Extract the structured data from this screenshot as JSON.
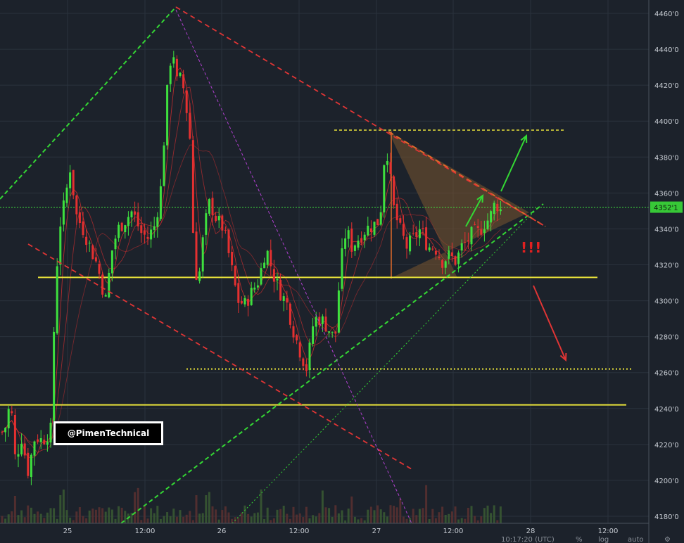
{
  "chart_data": {
    "type": "candlestick",
    "y_ticks": [
      "4460'0",
      "4440'0",
      "4420'0",
      "4400'0",
      "4380'0",
      "4360'0",
      "4340'0",
      "4320'0",
      "4300'0",
      "4280'0",
      "4260'0",
      "4240'0",
      "4220'0",
      "4200'0",
      "4180'0"
    ],
    "x_ticks": [
      "25",
      "12:00",
      "26",
      "12:00",
      "27",
      "12:00",
      "28",
      "12:00"
    ],
    "ylim": [
      4178,
      4466
    ],
    "current_price": "4352'1",
    "current_price_value": 4352.1,
    "levels": [
      {
        "name": "support-upper",
        "value": 4313,
        "style": "solid",
        "color": "#e8e23a"
      },
      {
        "name": "support-lower",
        "value": 4242,
        "style": "solid",
        "color": "#e8e23a"
      },
      {
        "name": "resistance-top",
        "value": 4395,
        "style": "dotted",
        "color": "#e8e23a"
      },
      {
        "name": "target-dotted",
        "value": 4262,
        "style": "dotted",
        "color": "#e8e23a"
      }
    ],
    "annotations": {
      "watermark": "@PimenTechnical",
      "exclaim": "!!!"
    },
    "colors": {
      "up": "#3ee03e",
      "down": "#e53030",
      "background": "#1c222b",
      "grid": "#2a323d",
      "support": "#e8e23a",
      "trend_green": "#34d834",
      "trend_red": "#e03535",
      "trend_purple": "#b040d0",
      "triangle_fill": "#7a5530"
    }
  },
  "footer": {
    "time": "10:17:20 (UTC)",
    "percent": "%",
    "log": "log",
    "auto": "auto"
  }
}
